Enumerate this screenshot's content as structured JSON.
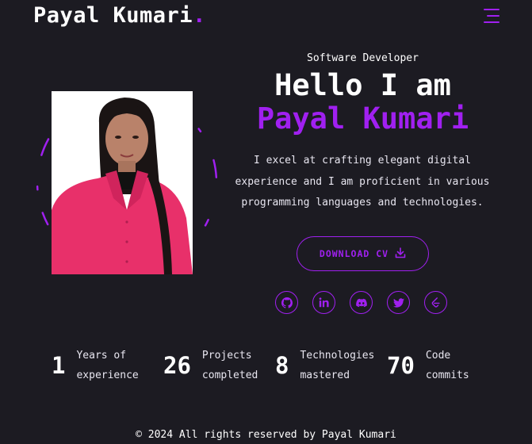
{
  "header": {
    "logo_text": "Payal Kumari",
    "logo_dot": ".",
    "menu_icon": "hamburger-menu-icon"
  },
  "hero": {
    "role": "Software Developer",
    "greeting": "Hello I am",
    "name": "Payal Kumari",
    "description_lines": [
      "I excel at crafting elegant digital",
      "experience and I am proficient in various",
      "programming languages and technologies."
    ],
    "download_label": "DOWNLOAD CV",
    "download_icon": "download-icon"
  },
  "socials": [
    {
      "icon": "github-icon"
    },
    {
      "icon": "linkedin-icon"
    },
    {
      "icon": "discord-icon"
    },
    {
      "icon": "twitter-icon"
    },
    {
      "icon": "leetcode-icon"
    }
  ],
  "stats": [
    {
      "value": "1",
      "label_line1": "Years of",
      "label_line2": "experience"
    },
    {
      "value": "26",
      "label_line1": "Projects",
      "label_line2": "completed"
    },
    {
      "value": "8",
      "label_line1": "Technologies",
      "label_line2": "mastered"
    },
    {
      "value": "70",
      "label_line1": "Code",
      "label_line2": "commits"
    }
  ],
  "footer": {
    "text": "© 2024 All rights reserved by Payal Kumari"
  },
  "colors": {
    "background": "#1c1b22",
    "accent": "#a020f0",
    "text": "#ffffff"
  }
}
